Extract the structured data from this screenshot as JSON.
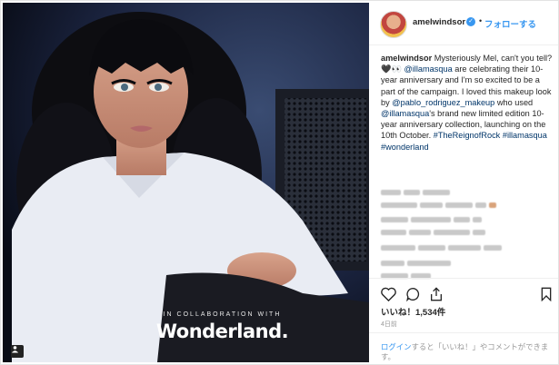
{
  "post": {
    "username": "amelwindsor",
    "follow_label": "フォローする",
    "verified_mark": "✓",
    "separator": "•",
    "image_caption_small": "IN COLLABORATION WITH",
    "image_caption_brand": "Wonderland.",
    "caption_parts": [
      {
        "t": "amelwindsor",
        "c": "u"
      },
      {
        "t": " Mysteriously Mel, can't you tell? 🖤👀 ",
        "c": ""
      },
      {
        "t": "@illamasqua",
        "c": "link"
      },
      {
        "t": " are celebrating their 10-year anniversary and I'm so excited to be a part of the campaign. I loved this makeup look by ",
        "c": ""
      },
      {
        "t": "@pablo_rodriguez_makeup",
        "c": "link"
      },
      {
        "t": " who used ",
        "c": ""
      },
      {
        "t": "@illamasqua",
        "c": "link"
      },
      {
        "t": "'s brand new limited edition 10-year anniversary collection, launching on the 10th October. ",
        "c": ""
      },
      {
        "t": "#TheReignofRock",
        "c": "link"
      },
      {
        "t": " ",
        "c": ""
      },
      {
        "t": "#illamasqua",
        "c": "link"
      },
      {
        "t": " ",
        "c": ""
      },
      {
        "t": "#wonderland",
        "c": "link"
      }
    ],
    "likes": "いいね！1,534件",
    "time_ago": "4日前",
    "login_prompt": {
      "login_link": "ログイン",
      "text": "すると「いいね！」やコメントができます。"
    }
  },
  "icons": {
    "like": "heart-icon",
    "comment": "comment-icon",
    "share": "share-icon",
    "save": "bookmark-icon",
    "photo_badge": "user-tag-icon"
  },
  "colors": {
    "link": "#003569",
    "accent": "#3897f0",
    "text": "#262626",
    "muted": "#999999"
  }
}
